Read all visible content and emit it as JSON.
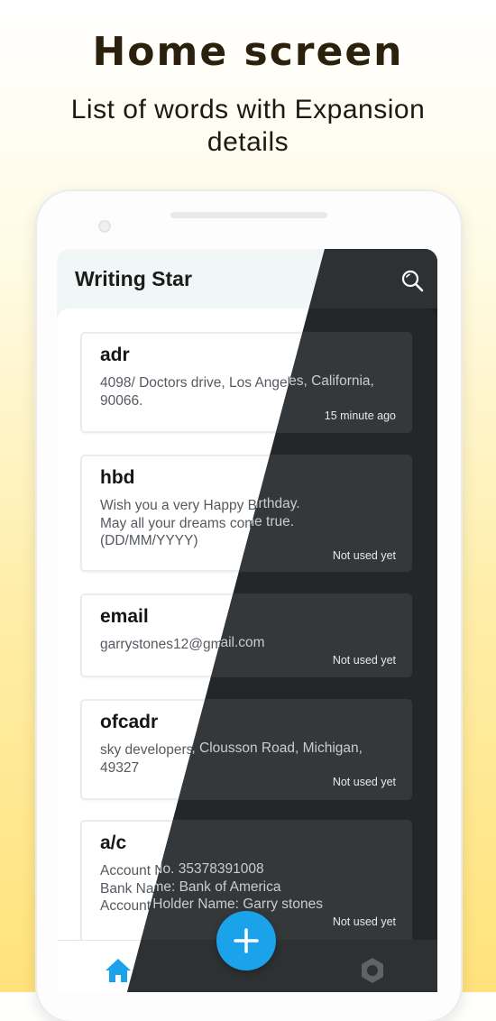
{
  "promo": {
    "headline": "Home screen",
    "subline": "List of words with Expansion details"
  },
  "app": {
    "title": "Writing Star",
    "accent_color": "#1aa3ea",
    "icons": [
      "search-icon",
      "home-icon",
      "settings-icon",
      "plus-icon"
    ]
  },
  "entries": [
    {
      "key": "adr",
      "expansion": "4098/ Doctors drive, Los Angeles, California,\n90066.",
      "status": "15 minute ago"
    },
    {
      "key": "hbd",
      "expansion": "Wish you a very Happy Birthday.\nMay all your dreams come true.\n(DD/MM/YYYY)",
      "status": "Not used yet"
    },
    {
      "key": "email",
      "expansion": "garrystones12@gmail.com",
      "status": "Not used yet"
    },
    {
      "key": "ofcadr",
      "expansion": "sky developers, Clousson Road, Michigan,\n49327",
      "status": "Not used yet"
    },
    {
      "key": "a/c",
      "expansion": "Account No. 35378391008\nBank Name: Bank of America\nAccount Holder Name: Garry stones",
      "status": "Not used yet"
    }
  ]
}
